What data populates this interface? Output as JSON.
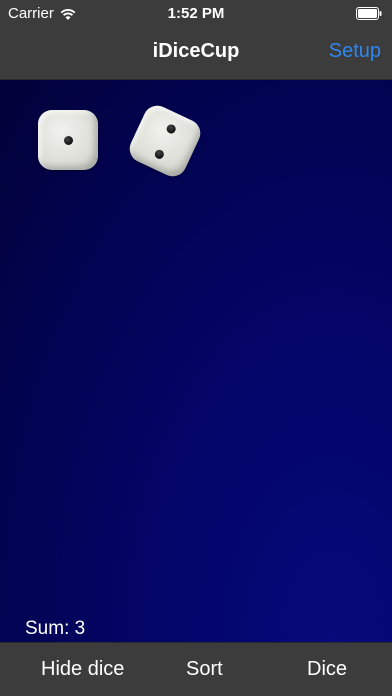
{
  "status_bar": {
    "carrier": "Carrier",
    "time": "1:52 PM",
    "wifi_icon": "wifi-icon",
    "battery_icon": "battery-icon"
  },
  "nav_bar": {
    "title": "iDiceCup",
    "setup_label": "Setup",
    "setup_color": "#2f87f0"
  },
  "dice": [
    {
      "value": 1
    },
    {
      "value": 2
    }
  ],
  "sum_label": "Sum: 3",
  "toolbar": {
    "hide_dice_label": "Hide dice",
    "sort_label": "Sort",
    "dice_label": "Dice"
  },
  "colors": {
    "bar_background": "#3c3c3c",
    "table_background": "#02034e",
    "accent": "#2f87f0"
  }
}
